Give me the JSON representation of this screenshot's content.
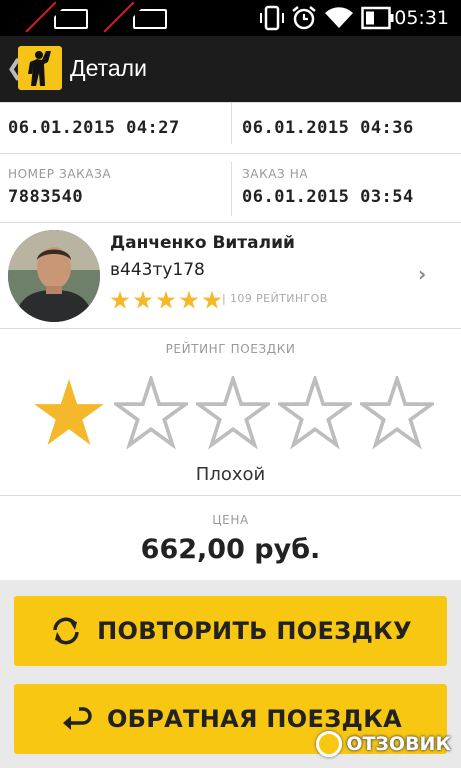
{
  "status_bar": {
    "time": "05:31",
    "icons": [
      "sim-1-disabled-icon",
      "sim-2-disabled-icon",
      "vibrate-icon",
      "alarm-icon",
      "wifi-icon",
      "battery-icon"
    ]
  },
  "app_bar": {
    "title": "Детали",
    "back_icon": "back-chevron-icon",
    "logo_icon": "taxi-hailing-person-logo"
  },
  "trip": {
    "start_time": "06.01.2015 04:27",
    "end_time": "06.01.2015 04:36",
    "order_number_label": "НОМЕР ЗАКАЗА",
    "order_number": "7883540",
    "order_for_label": "ЗАКАЗ НА",
    "order_for": "06.01.2015 03:54"
  },
  "driver": {
    "name": "Данченко Виталий",
    "plate": "в443ту178",
    "stars": 5,
    "ratings_text": "| 109 РЕЙТИНГОВ"
  },
  "trip_rating": {
    "label": "РЕЙТИНГ ПОЕЗДКИ",
    "value": 1,
    "max": 5,
    "text": "Плохой"
  },
  "price": {
    "label": "ЦЕНА",
    "value": "662,00 руб."
  },
  "buttons": {
    "repeat": "ПОВТОРИТЬ ПОЕЗДКУ",
    "return": "ОБРАТНАЯ ПОЕЗДКА"
  },
  "watermark": {
    "text": "ОТЗОВИК"
  },
  "colors": {
    "accent": "#f8c712",
    "star": "#f5b82a",
    "app_bar": "#1c1c1c"
  }
}
